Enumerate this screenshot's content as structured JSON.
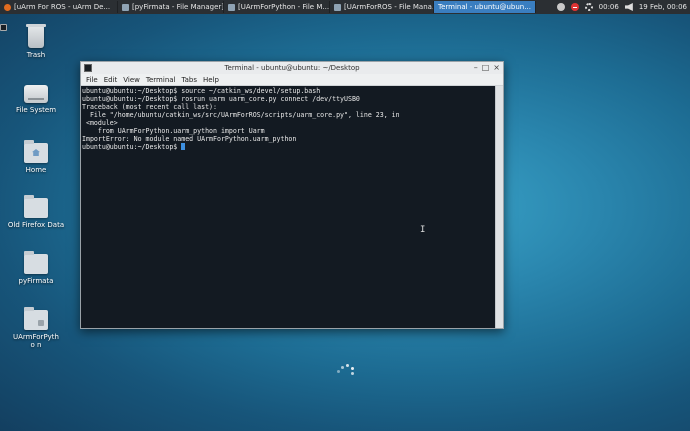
{
  "panel": {
    "tasks": [
      {
        "label": "[uArm For ROS - uArm De...",
        "icon": "firefox-icon"
      },
      {
        "label": "[pyFirmata - File Manager]",
        "icon": "folder-icon"
      },
      {
        "label": "[UArmForPython - File M...",
        "icon": "folder-icon"
      },
      {
        "label": "[UArmForROS - File Mana...",
        "icon": "folder-icon"
      },
      {
        "label": "Terminal - ubuntu@ubun...",
        "icon": "terminal-icon"
      }
    ],
    "clock_short": "00:06",
    "clock_date": "19 Feb, 00:06"
  },
  "desktop": {
    "icons": [
      {
        "label": "Trash"
      },
      {
        "label": "File System"
      },
      {
        "label": "Home"
      },
      {
        "label": "Old Firefox Data"
      },
      {
        "label": "pyFirmata"
      },
      {
        "label": "UArmForPytho n"
      }
    ]
  },
  "window": {
    "title": "Terminal - ubuntu@ubuntu: ~/Desktop",
    "controls": {
      "minimize": "–",
      "maximize": "□",
      "close": "×"
    },
    "menu": [
      "File",
      "Edit",
      "View",
      "Terminal",
      "Tabs",
      "Help"
    ],
    "lines": [
      "ubuntu@ubuntu:~/Desktop$ source ~/catkin_ws/devel/setup.bash",
      "ubuntu@ubuntu:~/Desktop$ rosrun uarm uarm_core.py connect /dev/ttyUSB0",
      "Traceback (most recent call last):",
      "  File \"/home/ubuntu/catkin_ws/src/UArmForROS/scripts/uarm_core.py\", line 23, in",
      " <module>",
      "    from UArmForPython.uarm_python import Uarm",
      "ImportError: No module named UArmForPython.uarm_python"
    ],
    "prompt": "ubuntu@ubuntu:~/Desktop$ "
  },
  "colors": {
    "terminal_bg": "#131a22",
    "panel_bg": "#2b2f33",
    "active_task": "#3a7ec0"
  }
}
